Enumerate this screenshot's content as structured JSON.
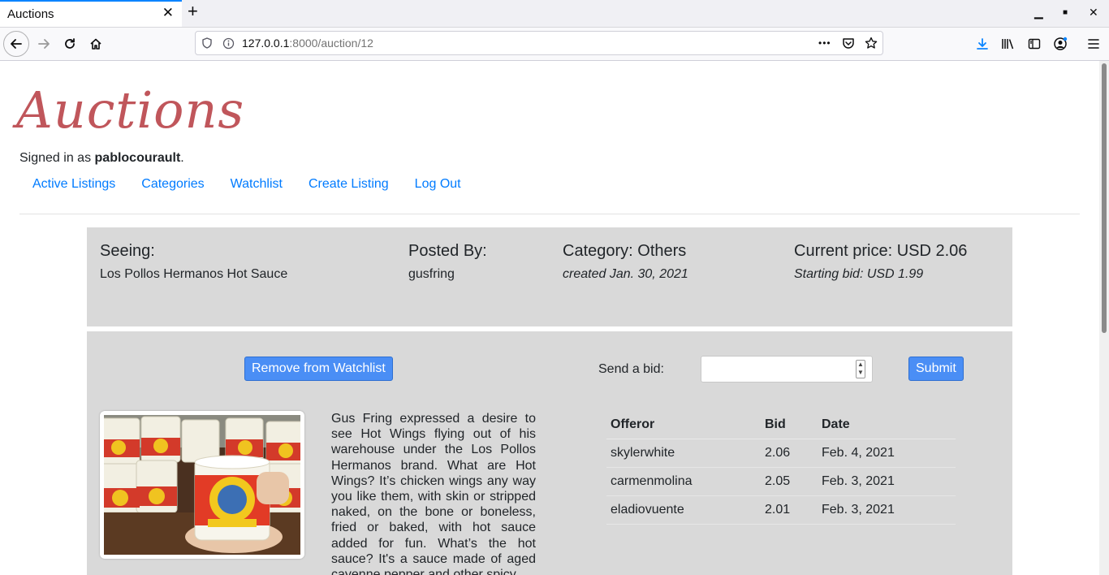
{
  "browser": {
    "tab_title": "Auctions",
    "tab_close": "✕",
    "new_tab": "+",
    "url_host": "127.0.0.1",
    "url_path": ":8000/auction/12",
    "url_more": "•••",
    "minimize": "▁",
    "maximize": "■",
    "close": "✕"
  },
  "site": {
    "title": "Auctions",
    "signed_in_prefix": "Signed in as ",
    "username": "pablocourault",
    "signed_in_suffix": ".",
    "nav": [
      "Active Listings",
      "Categories",
      "Watchlist",
      "Create Listing",
      "Log Out"
    ]
  },
  "listing": {
    "seeing_label": "Seeing:",
    "name": "Los Pollos Hermanos Hot Sauce",
    "posted_by_label": "Posted By:",
    "owner": "gusfring",
    "category_label": "Category: Others",
    "created": "created Jan. 30, 2021",
    "current_price_label": "Current price: USD 2.06",
    "starting_bid": "Starting bid: USD 1.99",
    "description": "Gus Fring expressed a desire to see Hot Wings flying out of his warehouse under the Los Pollos Hermanos brand. What are Hot Wings? It’s chicken wings any way you like them, with skin or stripped naked, on the bone or boneless, fried or baked, with hot sauce added for fun. What’s the hot sauce? It's a sauce made of aged cayenne pepper and other spicy"
  },
  "actions": {
    "watchlist_button": "Remove from Watchlist",
    "bid_label": "Send a bid:",
    "bid_value": "",
    "submit_button": "Submit"
  },
  "bids": {
    "headers": [
      "Offeror",
      "Bid",
      "Date"
    ],
    "rows": [
      [
        "skylerwhite",
        "2.06",
        "Feb. 4, 2021"
      ],
      [
        "carmenmolina",
        "2.05",
        "Feb. 3, 2021"
      ],
      [
        "eladiovuente",
        "2.01",
        "Feb. 3, 2021"
      ]
    ]
  },
  "colors": {
    "brand": "#c0565b",
    "link": "#007bff",
    "button": "#4a8ef5",
    "panel": "#d9d9d9"
  }
}
